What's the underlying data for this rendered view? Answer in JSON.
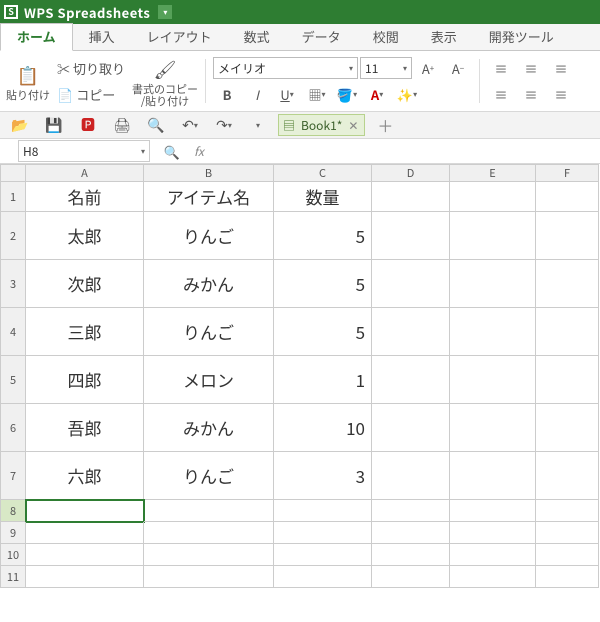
{
  "app": {
    "title": "WPS Spreadsheets"
  },
  "menu": {
    "home": "ホーム",
    "insert": "挿入",
    "layout": "レイアウト",
    "formula": "数式",
    "data": "データ",
    "review": "校閲",
    "view": "表示",
    "dev": "開発ツール"
  },
  "ribbon": {
    "paste": "貼り付け",
    "cut": "切り取り",
    "copy": "コピー",
    "format_painter_l1": "書式のコピー",
    "format_painter_l2": "/貼り付け",
    "font": "メイリオ",
    "font_size": "11"
  },
  "doc": {
    "name": "Book1*"
  },
  "namebox": "H8",
  "cols": [
    "A",
    "B",
    "C",
    "D",
    "E",
    "F"
  ],
  "headers": {
    "name": "名前",
    "item": "アイテム名",
    "qty": "数量"
  },
  "rows": [
    {
      "name": "太郎",
      "item": "りんご",
      "qty": "5"
    },
    {
      "name": "次郎",
      "item": "みかん",
      "qty": "5"
    },
    {
      "name": "三郎",
      "item": "りんご",
      "qty": "5"
    },
    {
      "name": "四郎",
      "item": "メロン",
      "qty": "1"
    },
    {
      "name": "吾郎",
      "item": "みかん",
      "qty": "10"
    },
    {
      "name": "六郎",
      "item": "りんご",
      "qty": "3"
    }
  ]
}
